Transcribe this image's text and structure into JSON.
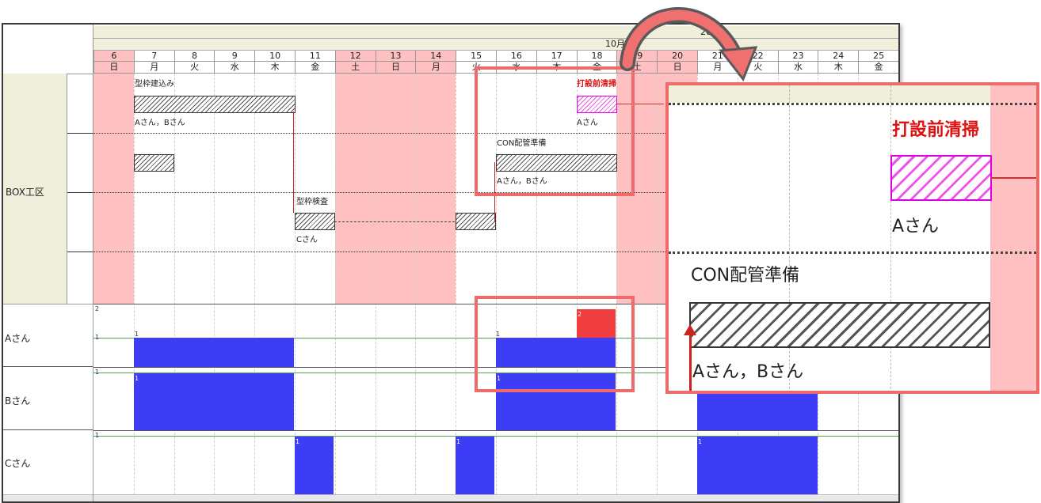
{
  "header": {
    "year_label": "202",
    "month_label": "10月",
    "days": [
      {
        "num": "6",
        "dow": "日",
        "holiday": true
      },
      {
        "num": "7",
        "dow": "月",
        "holiday": false
      },
      {
        "num": "8",
        "dow": "火",
        "holiday": false
      },
      {
        "num": "9",
        "dow": "水",
        "holiday": false
      },
      {
        "num": "10",
        "dow": "木",
        "holiday": false
      },
      {
        "num": "11",
        "dow": "金",
        "holiday": false
      },
      {
        "num": "12",
        "dow": "土",
        "holiday": true
      },
      {
        "num": "13",
        "dow": "日",
        "holiday": true
      },
      {
        "num": "14",
        "dow": "月",
        "holiday": true
      },
      {
        "num": "15",
        "dow": "火",
        "holiday": false
      },
      {
        "num": "16",
        "dow": "水",
        "holiday": false
      },
      {
        "num": "17",
        "dow": "木",
        "holiday": false
      },
      {
        "num": "18",
        "dow": "金",
        "holiday": false
      },
      {
        "num": "19",
        "dow": "土",
        "holiday": true
      },
      {
        "num": "20",
        "dow": "日",
        "holiday": true
      },
      {
        "num": "21",
        "dow": "月",
        "holiday": false
      },
      {
        "num": "22",
        "dow": "火",
        "holiday": false
      },
      {
        "num": "23",
        "dow": "水",
        "holiday": false
      },
      {
        "num": "24",
        "dow": "木",
        "holiday": false
      },
      {
        "num": "25",
        "dow": "金",
        "holiday": false
      }
    ]
  },
  "section": {
    "label": "BOX工区"
  },
  "tasks": {
    "katawaku": {
      "title": "型枠建込み",
      "workers": "Aさん，Bさん"
    },
    "kensa": {
      "title": "型枠検査",
      "workers": "Cさん"
    },
    "con": {
      "title": "CON配管準備",
      "workers": "Aさん，Bさん"
    },
    "seisou": {
      "title": "打設前清掃",
      "workers": "Aさん"
    }
  },
  "resources": [
    {
      "name": "Aさん",
      "max": "2",
      "base": "1",
      "peak": "2"
    },
    {
      "name": "Bさん",
      "base": "1"
    },
    {
      "name": "Cさん",
      "base": "1"
    }
  ],
  "colors": {
    "holiday": "#fec0c0",
    "bar": "#3d3df5",
    "over": "#f03c3c",
    "callout": "#ef6a6a",
    "section_bg": "#efefdc"
  },
  "zoom": {
    "seisou_title": "打設前清掃",
    "seisou_workers": "Aさん",
    "con_title": "CON配管準備",
    "con_workers": "Aさん，Bさん"
  }
}
